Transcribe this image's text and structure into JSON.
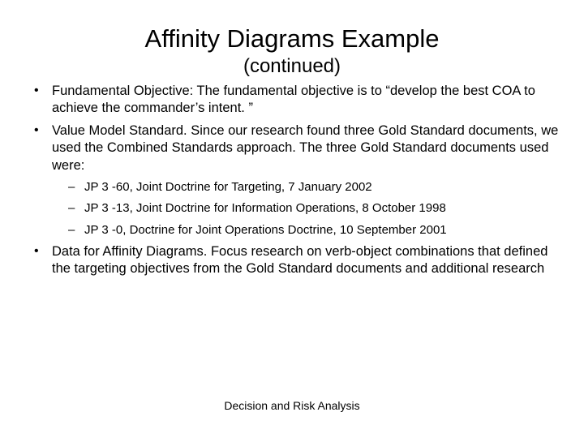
{
  "title": "Affinity Diagrams Example",
  "subtitle": "(continued)",
  "bullets": [
    {
      "text": "Fundamental Objective:   The fundamental objective is to “develop the best COA to achieve the commander’s intent. ”"
    },
    {
      "text": "Value Model Standard. Since our research found three Gold Standard documents, we used the Combined Standards approach. The three Gold Standard documents used were:",
      "sub": [
        "JP 3 -60, Joint Doctrine for Targeting, 7 January 2002",
        "JP 3 -13, Joint Doctrine for Information Operations, 8 October 1998",
        "JP 3 -0, Doctrine for Joint Operations Doctrine, 10 September 2001"
      ]
    },
    {
      "text": "Data for Affinity Diagrams. Focus research on verb-object combinations that defined the targeting objectives from the Gold Standard documents and additional research"
    }
  ],
  "footer": "Decision and Risk Analysis"
}
